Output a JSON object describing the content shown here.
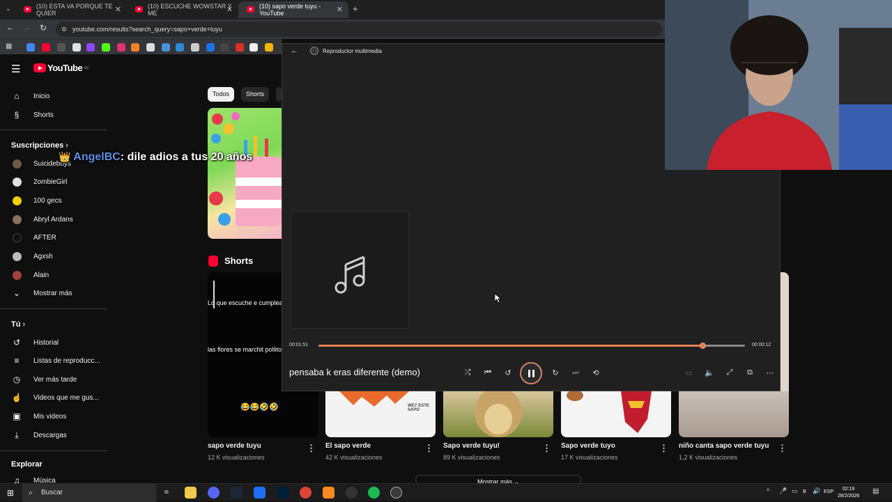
{
  "browser": {
    "tabs": [
      {
        "title": "(10) ESTA VA PORQUE TE QUIER"
      },
      {
        "title": "(10) ESCUCHE WOWSTAR Y ME"
      },
      {
        "title": "(10) sapo verde tuyu - YouTube"
      }
    ],
    "new_tab": "+",
    "url": "youtube.com/results?search_query=sapo+verde+tuyu"
  },
  "youtube": {
    "logo": "YouTube",
    "logo_region": "EC",
    "nav": [
      {
        "label": "Inicio",
        "icon": "home-icon"
      },
      {
        "label": "Shorts",
        "icon": "shorts-icon"
      }
    ],
    "subs_heading": "Suscripciones",
    "subscriptions": [
      {
        "label": "Suicideboys",
        "color": "#6b5a48"
      },
      {
        "label": "2ombieGirl",
        "color": "#e0e0e0"
      },
      {
        "label": "100 gecs",
        "color": "#f2d000"
      },
      {
        "label": "Abryl Ardans",
        "color": "#8a7060"
      },
      {
        "label": "AFTER",
        "color": "#111111"
      },
      {
        "label": "Agxsh",
        "color": "#bbbbbb"
      },
      {
        "label": "Alain",
        "color": "#a04040"
      }
    ],
    "show_more": "Mostrar más",
    "you_heading": "Tú",
    "you_items": [
      {
        "label": "Historial",
        "icon": "history-icon"
      },
      {
        "label": "Listas de reproducc...",
        "icon": "playlists-icon"
      },
      {
        "label": "Ver más tarde",
        "icon": "watch-later-icon"
      },
      {
        "label": "Videos que me gus...",
        "icon": "like-icon"
      },
      {
        "label": "Mis videos",
        "icon": "my-videos-icon"
      },
      {
        "label": "Descargas",
        "icon": "download-icon"
      }
    ],
    "explore_heading": "Explorar",
    "explore_items": [
      {
        "label": "Música",
        "icon": "music-icon"
      }
    ],
    "chips": [
      "Todos",
      "Shorts"
    ],
    "shorts_heading": "Shorts",
    "short_overlay_1": "Lo que escuche e cumpleaños 😂",
    "short_overlay_2": "las flores se marchit pollitos se suicid",
    "short_overlay_3": "😂😂🤣🤣",
    "short_overlay_4": "WEY ESTE SAPO",
    "shorts": [
      {
        "title": "sapo verde tuyu",
        "views": "12 K visualizaciones"
      },
      {
        "title": "El sapo verde",
        "views": "42 K visualizaciones"
      },
      {
        "title": "Sapo verde tuyu!",
        "views": "89 K visualizaciones"
      },
      {
        "title": "Sapo verde tuyo",
        "views": "17 K visualizaciones"
      },
      {
        "title": "niño canta sapo verde tuyu",
        "views": "1,2 K visualizaciones"
      }
    ],
    "show_more_button": "Mostrar más"
  },
  "chat_overlay": {
    "user": "AngelBC",
    "message": ": dile adios a tus 20 años"
  },
  "player": {
    "app_title": "Reproductor multimedia",
    "song_title": "pensaba k eras diferente (demo)",
    "elapsed": "00:01:51",
    "remaining": "00:00:12",
    "progress": 0.9,
    "accent": "#e67e50"
  },
  "taskbar": {
    "search_placeholder": "Buscar",
    "lang": "ESP",
    "time": "02:19",
    "date": "28/2/2026"
  }
}
